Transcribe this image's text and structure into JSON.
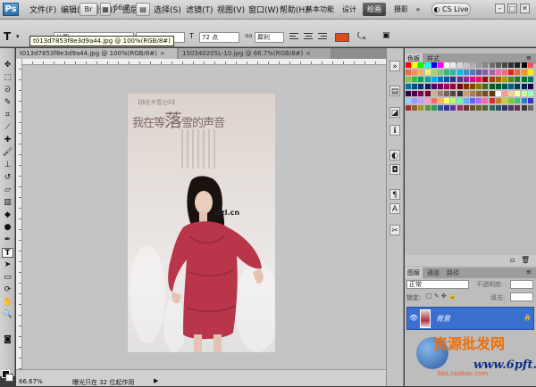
{
  "app": {
    "logo": "Ps"
  },
  "menu": [
    "文件(F)",
    "编辑(E)",
    "图像(I)",
    "图层(L)",
    "选择(S)",
    "滤镜(T)",
    "视图(V)",
    "窗口(W)",
    "帮助(H)"
  ],
  "menubar": {
    "zoom": "66.7",
    "workspaces": [
      "基本功能",
      "设计",
      "绘画",
      "摄影"
    ],
    "active_workspace": "绘画",
    "more": "»",
    "cslive": "CS Live"
  },
  "options": {
    "tooltip": "t013d7853f8e3d9a44.jpg @ 100%(RGB/8#)",
    "font_family": "幼圆",
    "font_size": "72 点",
    "antialias": "犀利",
    "text_color": "#e04a12"
  },
  "documents": [
    {
      "title": "t013d7853f8e3d9a44.jpg @ 100%(RGB/8#)",
      "active": true
    },
    {
      "title": "150340205L-10.jpg @ 66.7%(RGB/8#)",
      "active": false
    }
  ],
  "photo": {
    "small_tag": "【我在冬雪之中】",
    "heading_a": "我在等",
    "heading_b": "落",
    "heading_c": "雪的声音",
    "watermark": "zfzl.cn"
  },
  "status": {
    "zoom": "66.67%",
    "text": "曝光只在 32 位起作用"
  },
  "panels": {
    "swatch_tabs": [
      "色板",
      "样式"
    ],
    "layer_tabs": [
      "图层",
      "通道",
      "路径"
    ],
    "blend_mode": "正常",
    "opacity_label": "不透明度:",
    "lock_label": "锁定:",
    "fill_label": "填充:",
    "layer_name": "背景"
  },
  "site": {
    "name": "资源批发网",
    "url": "www.6pft.cn",
    "sub": "bbs.taobao.com"
  }
}
